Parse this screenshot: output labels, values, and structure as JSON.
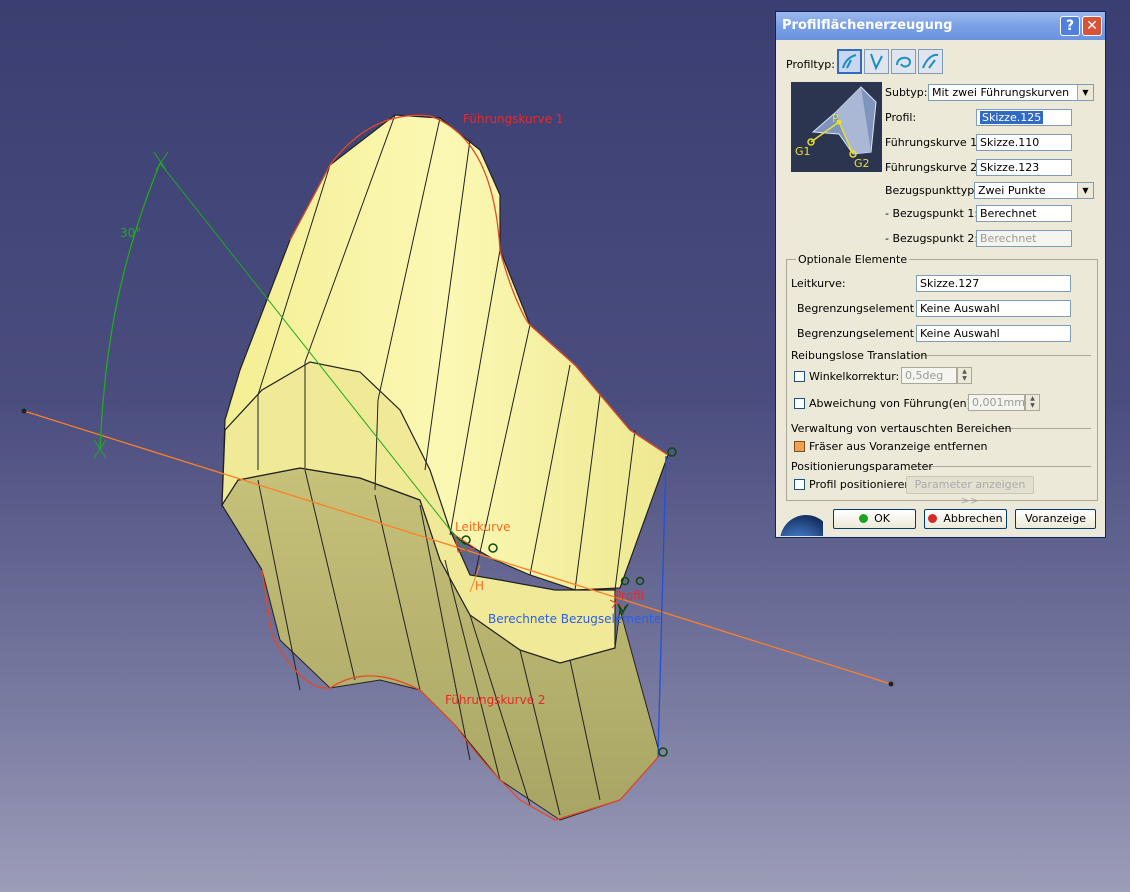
{
  "viewport": {
    "labels": {
      "fuehrungskurve1": "Führungskurve 1",
      "fuehrungskurve2": "Führungskurve 2",
      "leitkurve": "Leitkurve",
      "angle": "30°",
      "bezugselemente": "Berechnete Bezugselemente",
      "profil": "Profil",
      "h_axis": "H",
      "v_axis": "V"
    }
  },
  "dialog": {
    "title": "Profilflächenerzeugung",
    "help": "?",
    "close": "✕",
    "profiltyp_label": "Profiltyp:",
    "preview": {
      "g1": "G1",
      "g2": "G2",
      "p": "P"
    },
    "subtyp": {
      "label": "Subtyp:",
      "value": "Mit zwei Führungskurven"
    },
    "profil": {
      "label": "Profil:",
      "value": "Skizze.125"
    },
    "fk1": {
      "label": "Führungskurve 1:",
      "value": "Skizze.110"
    },
    "fk2": {
      "label": "Führungskurve 2:",
      "value": "Skizze.123"
    },
    "bezugspunkttyp": {
      "label": "Bezugspunkttyp:",
      "value": "Zwei Punkte"
    },
    "bp1": {
      "label": "- Bezugspunkt 1:",
      "value": "Berechnet"
    },
    "bp2": {
      "label": "- Bezugspunkt 2:",
      "value": "Berechnet"
    },
    "optional": {
      "title": "Optionale Elemente",
      "leitkurve": {
        "label": "Leitkurve:",
        "value": "Skizze.127"
      },
      "begr1": {
        "label": "Begrenzungselement 1:",
        "value": "Keine Auswahl"
      },
      "begr2": {
        "label": "Begrenzungselement 2:",
        "value": "Keine Auswahl"
      },
      "translation_title": "Reibungslose Translation",
      "winkel": {
        "label": "Winkelkorrektur:",
        "value": "0,5deg"
      },
      "abweichung": {
        "label": "Abweichung von Führung(en):",
        "value": "0,001mm"
      },
      "verwaltung_title": "Verwaltung von vertauschten Bereichen",
      "fraeser": {
        "label": "Fräser aus Voranzeige entfernen"
      },
      "position_title": "Positionierungsparameter",
      "profil_pos": {
        "label": "Profil positionieren"
      },
      "param_btn": "Parameter anzeigen >>"
    },
    "buttons": {
      "ok": "OK",
      "cancel": "Abbrechen",
      "preview": "Voranzeige"
    },
    "colors": {
      "ok_dot": "#1fa31f",
      "cancel_dot": "#d52a2a"
    }
  }
}
